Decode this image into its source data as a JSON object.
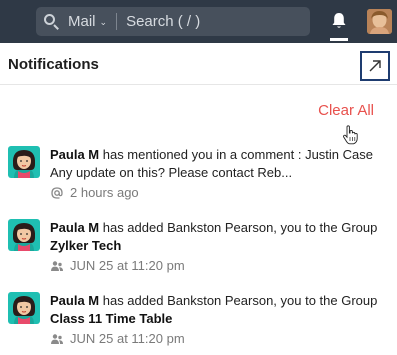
{
  "topbar": {
    "search_scope": "Mail",
    "search_placeholder": "Search ( / )"
  },
  "panel": {
    "title": "Notifications",
    "clear_all": "Clear All"
  },
  "notifications": [
    {
      "actor": "Paula M",
      "text_before": " has mentioned you in a comment : Justin Case Any update on this? Please contact Reb...",
      "group_prefix": "",
      "group": "",
      "meta_icon": "at-icon",
      "meta": "2 hours ago"
    },
    {
      "actor": "Paula M",
      "text_before": " has added Bankston Pearson, you to the Group ",
      "group": "Zylker Tech",
      "meta_icon": "group-icon",
      "meta": "JUN 25 at 11:20 pm"
    },
    {
      "actor": "Paula M",
      "text_before": " has added Bankston Pearson, you to the Group ",
      "group": "Class 11 Time Table",
      "meta_icon": "group-icon",
      "meta": "JUN 25 at 11:20 pm"
    }
  ],
  "colors": {
    "topbar_bg": "#2f3946",
    "accent_red": "#e8514d",
    "popout_border": "#1e3c70"
  }
}
